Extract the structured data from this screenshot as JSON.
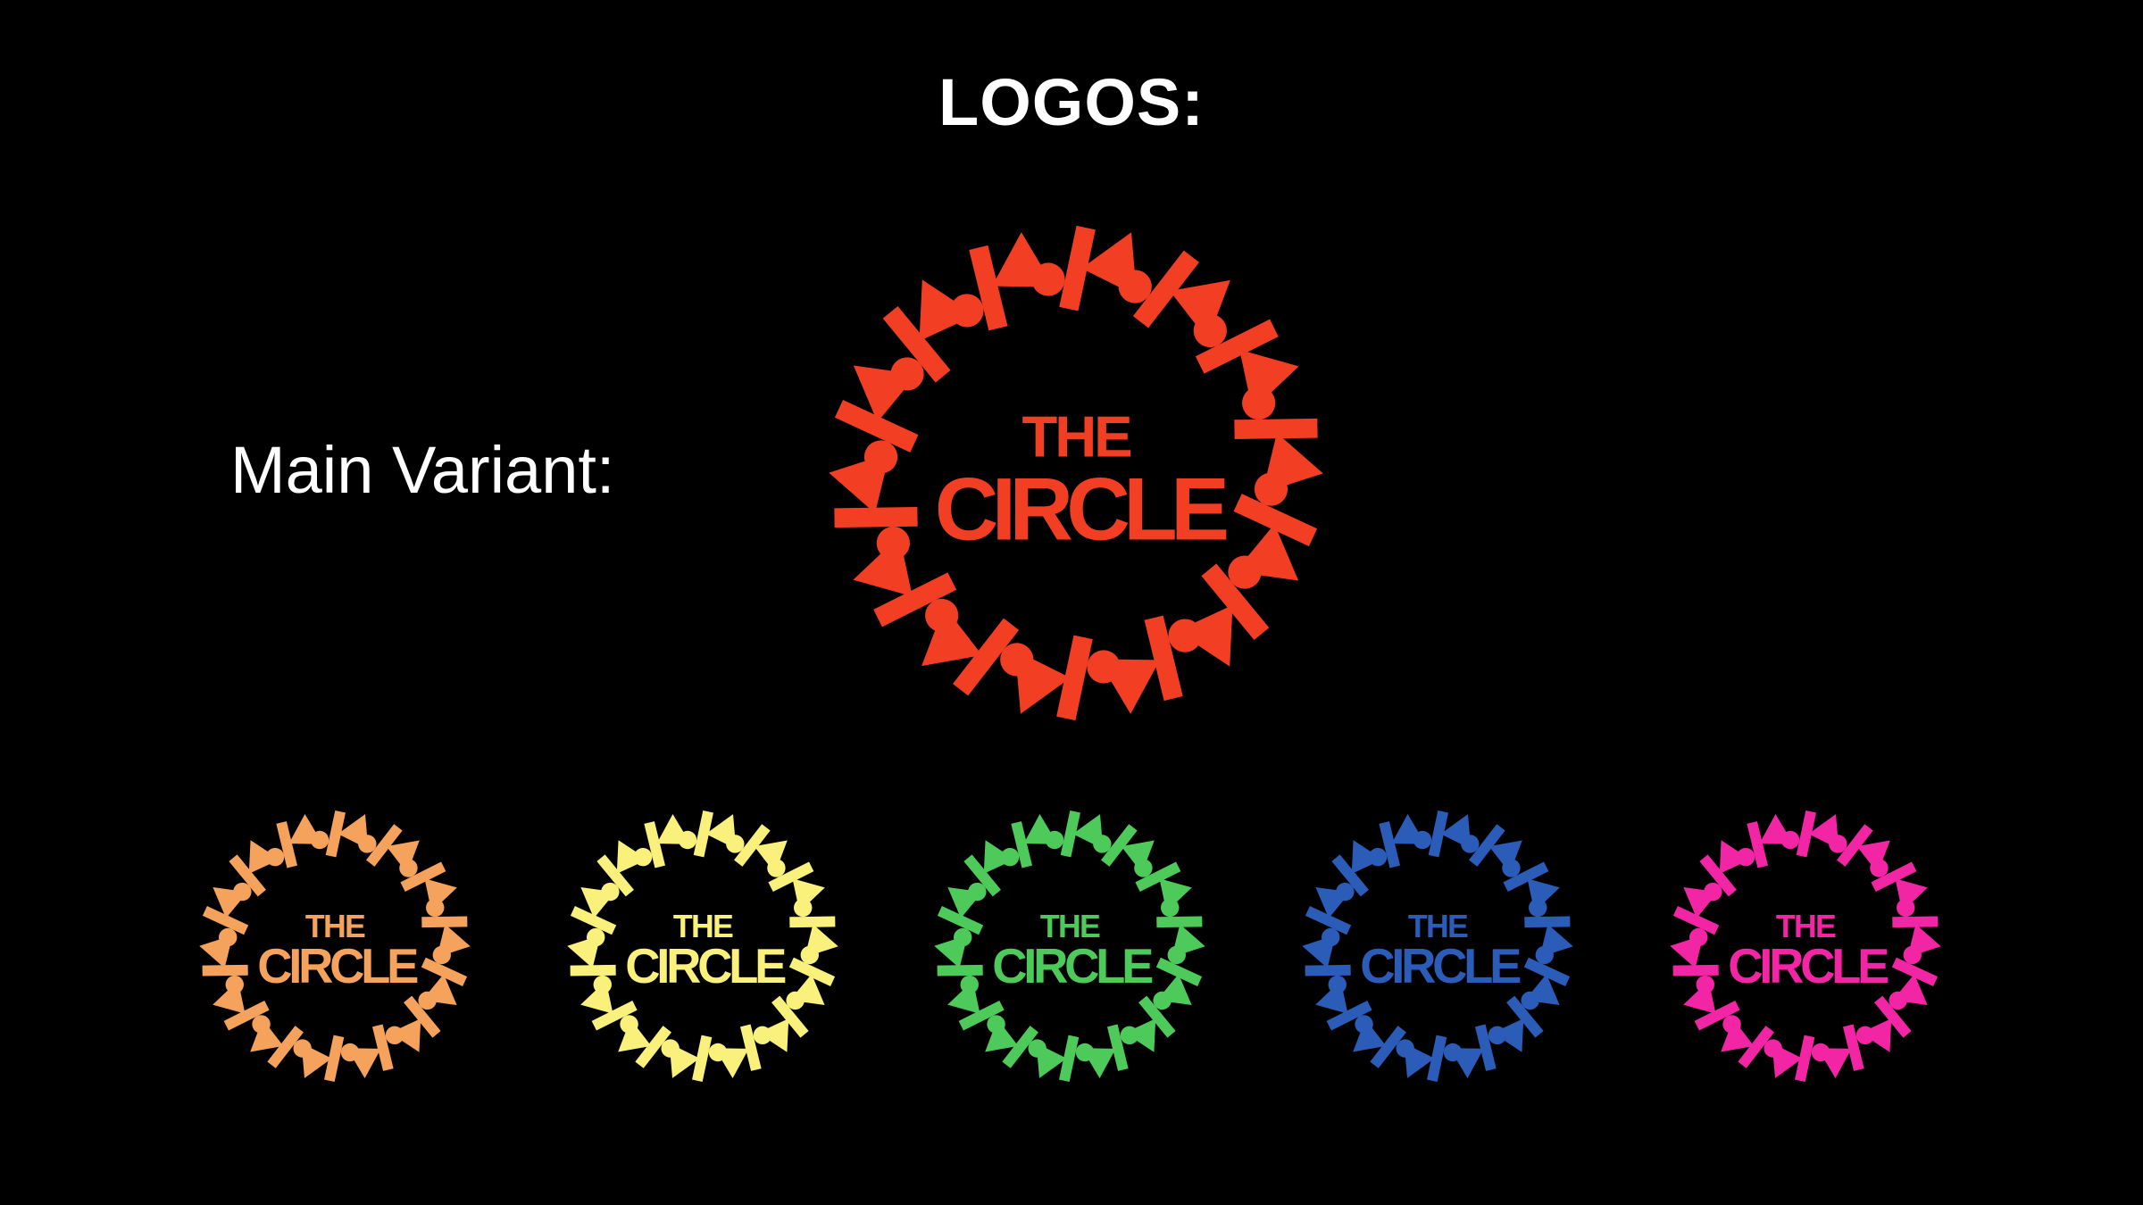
{
  "page": {
    "title": "LOGOS:",
    "variant_label": "Main Variant:"
  },
  "logos": [
    {
      "id": "main",
      "wordmark": [
        "THE",
        "CIRCLE"
      ],
      "color": "#F23F24"
    },
    {
      "id": "orange",
      "wordmark": [
        "THE",
        "CIRCLE"
      ],
      "color": "#F5A35C"
    },
    {
      "id": "yellow",
      "wordmark": [
        "THE",
        "CIRCLE"
      ],
      "color": "#FAF17C"
    },
    {
      "id": "green",
      "wordmark": [
        "THE",
        "CIRCLE"
      ],
      "color": "#4ECA5B"
    },
    {
      "id": "blue",
      "wordmark": [
        "THE",
        "CIRCLE"
      ],
      "color": "#2B5CB8"
    },
    {
      "id": "pink",
      "wordmark": [
        "THE",
        "CIRCLE"
      ],
      "color": "#F226A5"
    }
  ],
  "icon": "circle-of-people-icon"
}
